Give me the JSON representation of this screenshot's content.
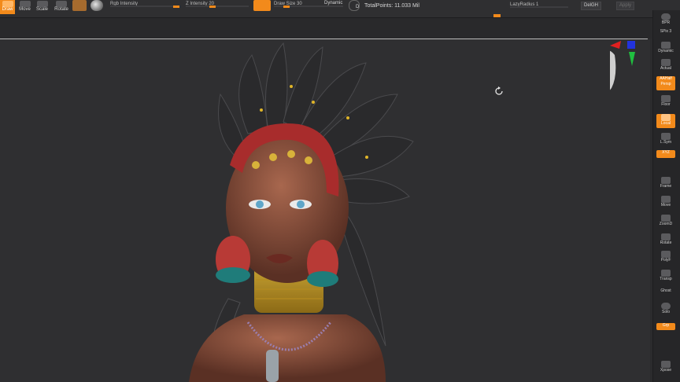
{
  "toolbar": {
    "draw": "Draw",
    "move": "Move",
    "scale": "Scale",
    "rotate": "Rotate",
    "rgb_intensity": "Rgb Intensity",
    "z_intensity": "Z Intensity 20",
    "draw_size": "Draw Size 30",
    "dynamic": "Dynamic",
    "focal_d": "D",
    "total_points": "TotalPoints: 11.033 Mil",
    "lazy_radius": "LazyRadius 1",
    "delgh": "DelGH",
    "apply": "Apply"
  },
  "right_shelf": {
    "items": [
      "BPR",
      "SPix 3",
      "Dynamic",
      "Actual",
      "AAHalf",
      "Persp",
      "Floor",
      "Local",
      "L.Sym",
      "XYZ",
      "Frame",
      "Move",
      "ZoomD",
      "Rotate",
      "PolyF",
      "Transp",
      "Ghost",
      "Solo",
      "Grp",
      "Xpose"
    ]
  },
  "colors": {
    "accent": "#f28a1b",
    "background": "#2f2f31",
    "panel": "#262628"
  },
  "icons": {
    "gizmo": "axis-gizmo-icon",
    "cursor": "refresh-cursor-icon"
  }
}
